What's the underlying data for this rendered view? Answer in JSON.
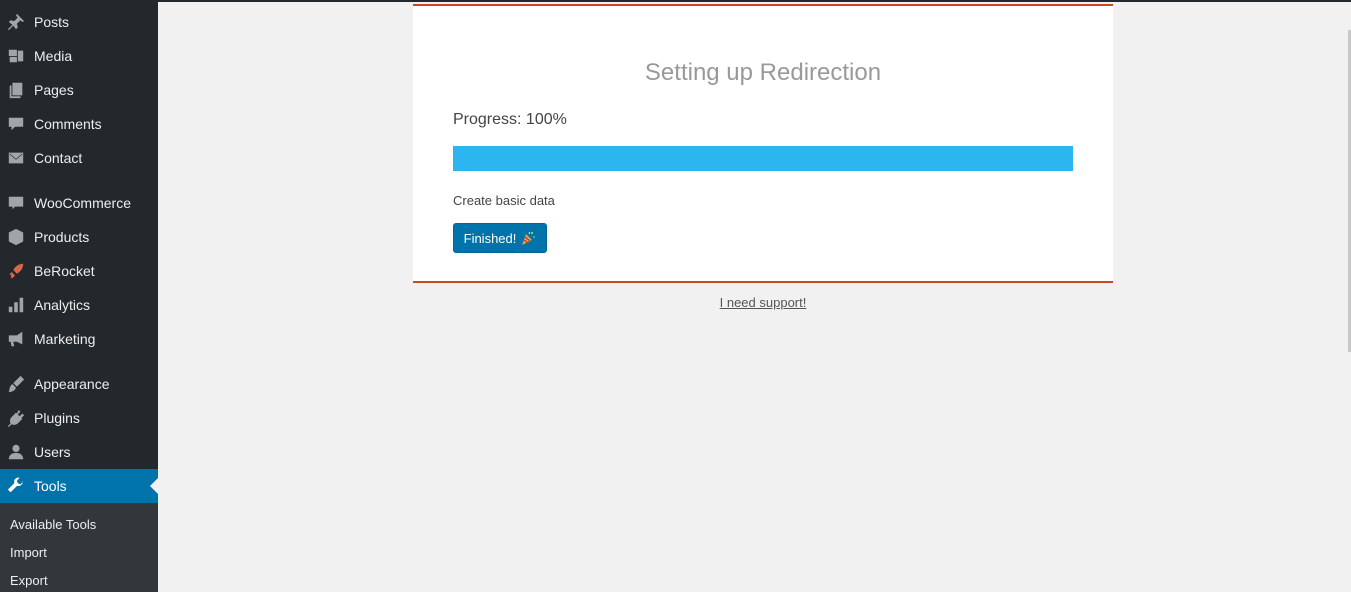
{
  "sidebar": {
    "items": [
      {
        "label": "Posts",
        "icon": "pin-icon"
      },
      {
        "label": "Media",
        "icon": "media-icon"
      },
      {
        "label": "Pages",
        "icon": "pages-icon"
      },
      {
        "label": "Comments",
        "icon": "comment-icon"
      },
      {
        "label": "Contact",
        "icon": "envelope-icon"
      },
      {
        "label": "WooCommerce",
        "icon": "woo-icon"
      },
      {
        "label": "Products",
        "icon": "box-icon"
      },
      {
        "label": "BeRocket",
        "icon": "rocket-icon"
      },
      {
        "label": "Analytics",
        "icon": "bar-chart-icon"
      },
      {
        "label": "Marketing",
        "icon": "megaphone-icon"
      },
      {
        "label": "Appearance",
        "icon": "brush-icon"
      },
      {
        "label": "Plugins",
        "icon": "plug-icon"
      },
      {
        "label": "Users",
        "icon": "user-icon"
      },
      {
        "label": "Tools",
        "icon": "wrench-icon",
        "active": true
      }
    ],
    "submenu": [
      {
        "label": "Available Tools"
      },
      {
        "label": "Import"
      },
      {
        "label": "Export"
      }
    ]
  },
  "setup": {
    "title": "Setting up Redirection",
    "progress_label": "Progress: 100%",
    "progress": 100,
    "step_text": "Create basic data",
    "button_label": "Finished!"
  },
  "support_link": "I need support!",
  "colors": {
    "accent": "#0073aa",
    "progress": "#2cb5ee",
    "card_border": "#ca4a1f",
    "sidebar_bg": "#23282d"
  }
}
